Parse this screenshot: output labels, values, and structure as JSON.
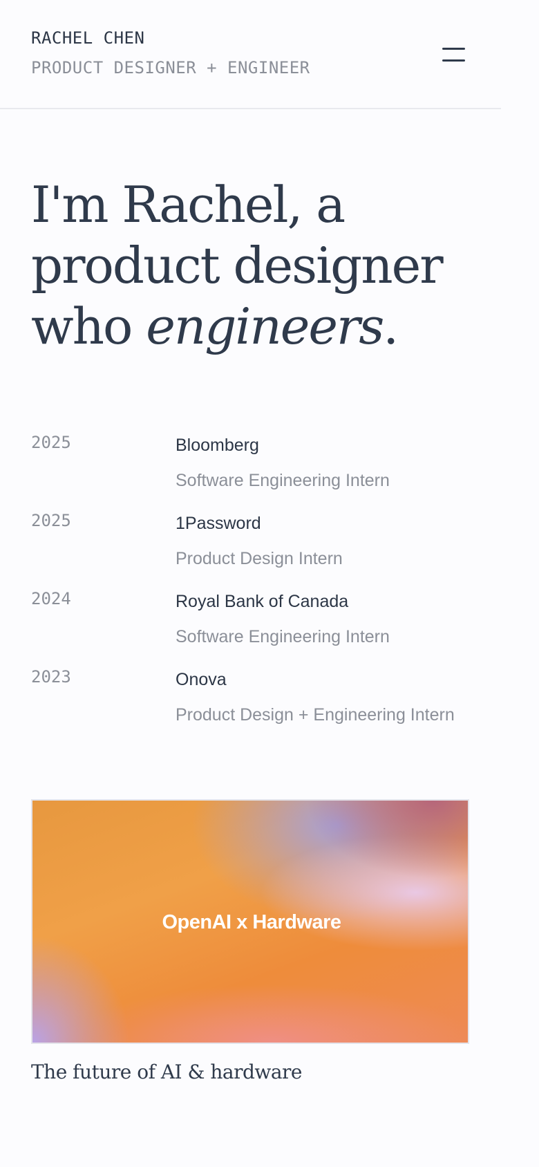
{
  "header": {
    "name": "RACHEL CHEN",
    "role": "PRODUCT DESIGNER + ENGINEER",
    "menu_icon": "hamburger-menu-icon"
  },
  "hero": {
    "line_prefix": "I'm Rachel, a product designer who ",
    "emphasis": "engineers",
    "suffix": "."
  },
  "experience": [
    {
      "year": "2025",
      "company": "Bloomberg",
      "role": "Software Engineering Intern"
    },
    {
      "year": "2025",
      "company": "1Password",
      "role": "Product Design Intern"
    },
    {
      "year": "2024",
      "company": "Royal Bank of Canada",
      "role": "Software Engineering Intern"
    },
    {
      "year": "2023",
      "company": "Onova",
      "role": "Product Design + Engineering Intern"
    }
  ],
  "project": {
    "card_label": "OpenAI x Hardware",
    "caption": "The future of AI & hardware",
    "gradient_colors": [
      "#e7983f",
      "#ee8c3b",
      "#b9a2e6",
      "#ef8f84",
      "#a6a0d6",
      "#e9c8e4",
      "#b6667a"
    ]
  }
}
